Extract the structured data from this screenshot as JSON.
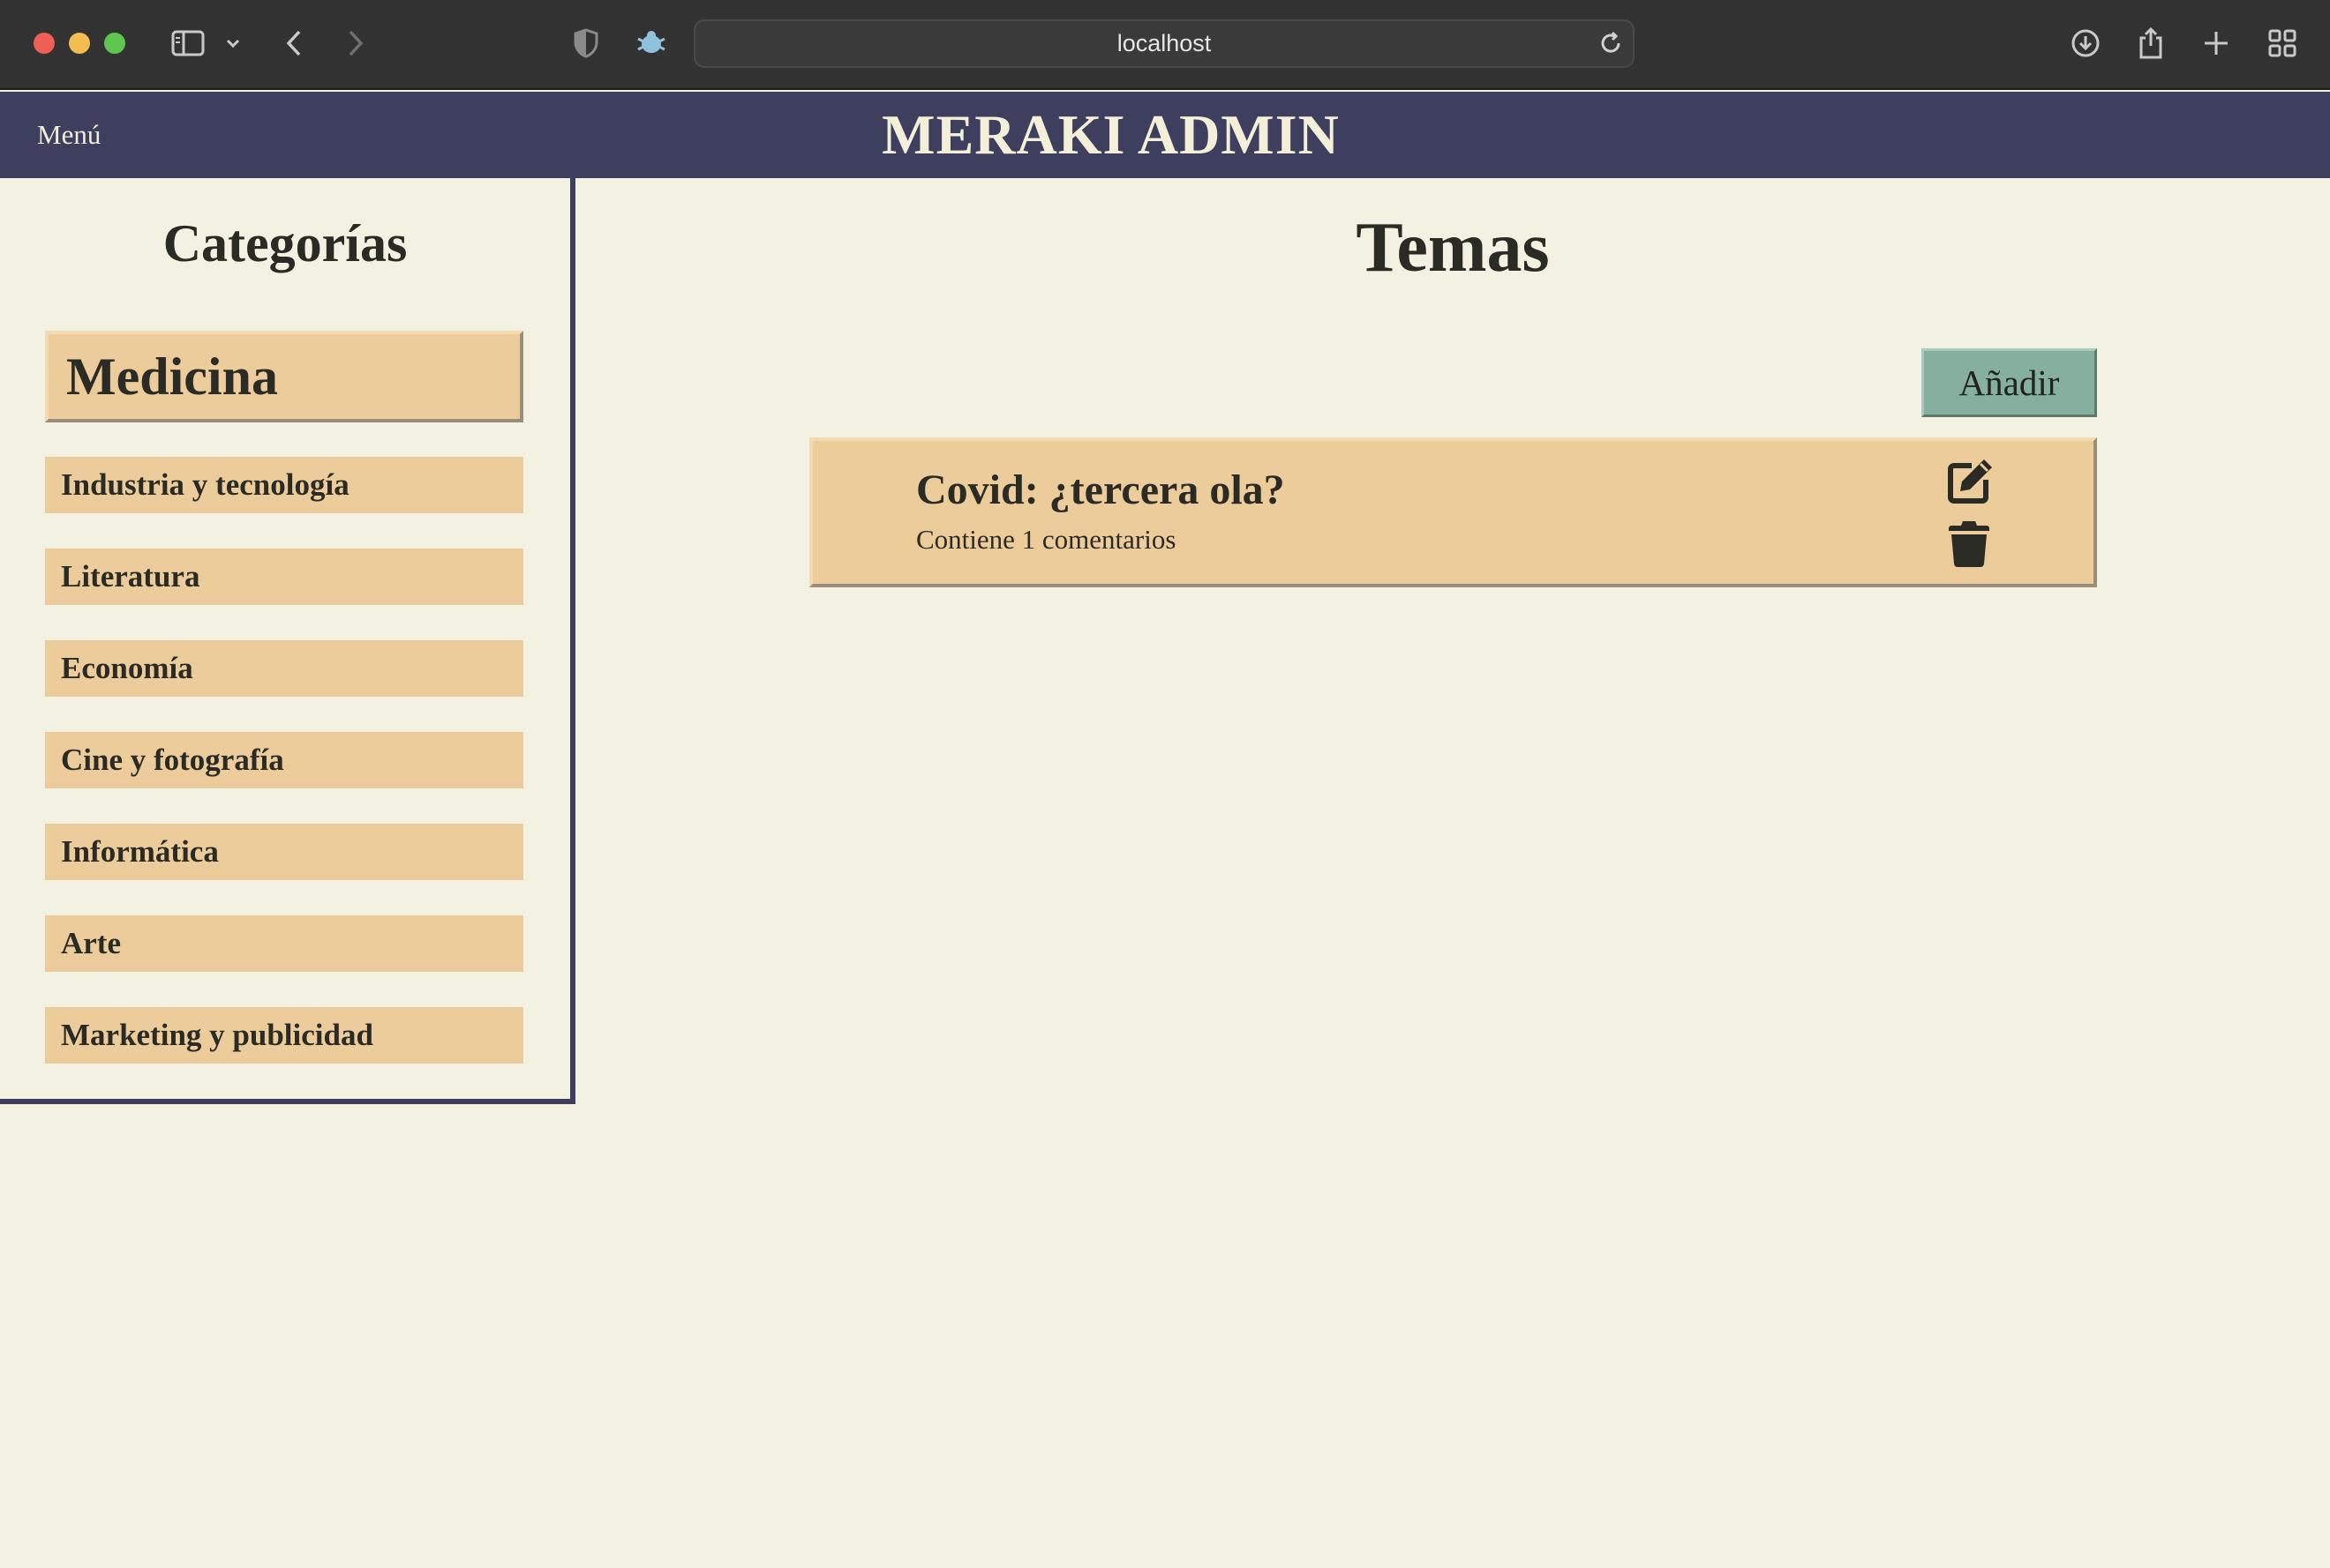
{
  "browser": {
    "url": "localhost",
    "icons": [
      "sidebar-icon",
      "chevron-down-icon",
      "back-icon",
      "forward-icon",
      "shield-icon",
      "extension-icon",
      "reload-icon",
      "download-icon",
      "share-icon",
      "new-tab-icon",
      "tab-overview-icon"
    ]
  },
  "header": {
    "menu_label": "Menú",
    "brand": "MERAKI ADMIN",
    "background": "#3e3e5e"
  },
  "sidebar": {
    "title": "Categorías",
    "active_category": "Medicina",
    "categories": [
      "Industria y tecnología",
      "Literatura",
      "Economía",
      "Cine y fotografía",
      "Informática",
      "Arte",
      "Marketing y publicidad"
    ]
  },
  "main": {
    "title": "Temas",
    "add_label": "Añadir",
    "topics": [
      {
        "title": "Covid: ¿tercera ola?",
        "subtitle": "Contiene 1 comentarios",
        "icons": [
          "edit-icon",
          "trash-icon"
        ]
      }
    ]
  },
  "colors": {
    "page_bg": "#f3f1e1",
    "card_bg": "#eccc9a",
    "add_button": "#85b09d",
    "text": "#2b2b26"
  }
}
